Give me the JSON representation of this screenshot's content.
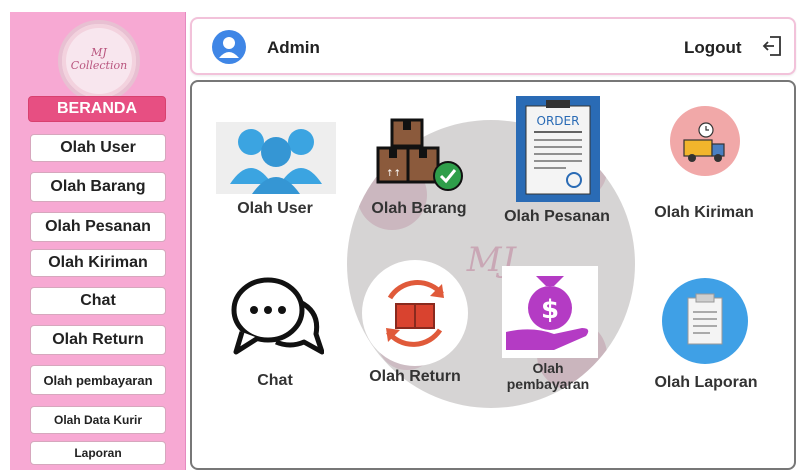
{
  "sidebar": {
    "logo_text": "MJ Collection",
    "items": [
      {
        "label": "BERANDA"
      },
      {
        "label": "Olah User"
      },
      {
        "label": "Olah Barang"
      },
      {
        "label": "Olah Pesanan"
      },
      {
        "label": "Olah Kiriman"
      },
      {
        "label": "Chat"
      },
      {
        "label": "Olah Return"
      },
      {
        "label": "Olah pembayaran"
      },
      {
        "label": "Olah Data Kurir"
      },
      {
        "label": "Laporan"
      }
    ]
  },
  "header": {
    "user_name": "Admin",
    "logout_label": "Logout"
  },
  "main": {
    "watermark_text": "MJ",
    "tiles": [
      {
        "label": "Olah User",
        "icon": "users-icon"
      },
      {
        "label": "Olah Barang",
        "icon": "boxes-check-icon"
      },
      {
        "label": "Olah Pesanan",
        "icon": "order-clipboard-icon"
      },
      {
        "label": "Olah Kiriman",
        "icon": "delivery-truck-icon"
      },
      {
        "label": "Chat",
        "icon": "chat-bubbles-icon"
      },
      {
        "label": "Olah Return",
        "icon": "return-box-icon"
      },
      {
        "label": "Olah",
        "label2": "pembayaran",
        "icon": "money-hand-icon"
      },
      {
        "label": "Olah Laporan",
        "icon": "report-clipboard-icon"
      }
    ]
  },
  "colors": {
    "sidebar_bg": "#f7a9d3",
    "active_menu": "#e74f82",
    "avatar_blue": "#3f86e6"
  }
}
